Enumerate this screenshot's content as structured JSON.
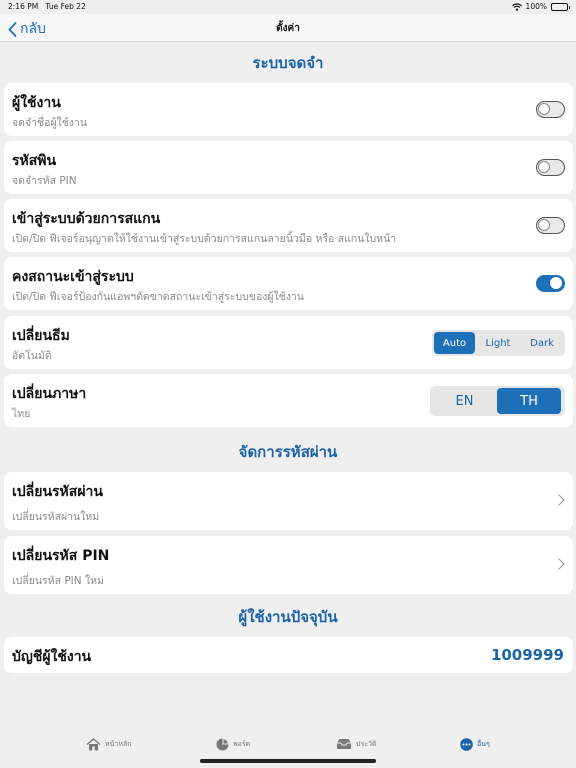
{
  "status": {
    "time": "2:16 PM",
    "date": "Tue Feb 22",
    "battery": "100%"
  },
  "nav": {
    "back_label": "กลับ",
    "title": "ตั้งค่า"
  },
  "sections": {
    "memory": "ระบบจดจำ",
    "password": "จัดการรหัสผ่าน",
    "current_user": "ผู้ใช้งานปัจจุบัน"
  },
  "settings": {
    "username": {
      "title": "ผู้ใช้งาน",
      "subtitle": "จดจำชื่อผู้ใช้งาน",
      "on": false
    },
    "pin": {
      "title": "รหัสพิน",
      "subtitle": "จดจำรหัส PIN",
      "on": false
    },
    "scan": {
      "title": "เข้าสู่ระบบด้วยการสแกน",
      "subtitle": "เปิด/ปิด ฟีเจอร์อนุญาตให้ใช้งานเข้าสู่ระบบด้วยการสแกนลายนิ้วมือ หรือ สแกนใบหน้า",
      "on": false
    },
    "keep_login": {
      "title": "คงสถานะเข้าสู่ระบบ",
      "subtitle": "เปิด/ปิด ฟีเจอร์ป้องกันแอพฯตัดขาดสถานะเข้าสู่ระบบของผู้ใช้งาน",
      "on": true
    },
    "theme": {
      "title": "เปลี่ยนธีม",
      "subtitle": "อัตโนมัติ",
      "options": [
        "Auto",
        "Light",
        "Dark"
      ],
      "selected": "Auto"
    },
    "language": {
      "title": "เปลี่ยนภาษา",
      "subtitle": "ไทย",
      "options": [
        "EN",
        "TH"
      ],
      "selected": "TH"
    }
  },
  "password": {
    "change_password": {
      "title": "เปลี่ยนรหัสผ่าน",
      "subtitle": "เปลี่ยนรหัสผ่านใหม่"
    },
    "change_pin": {
      "title": "เปลี่ยนรหัส PIN",
      "subtitle": "เปลี่ยนรหัส PIN ใหม่"
    }
  },
  "account": {
    "label": "บัญชีผู้ใช้งาน",
    "value": "1009999"
  },
  "tabs": [
    {
      "label": "หน้าหลัก",
      "icon": "home-icon"
    },
    {
      "label": "พอร์ต",
      "icon": "pie-chart-icon"
    },
    {
      "label": "ประวัติ",
      "icon": "inbox-icon"
    },
    {
      "label": "อื่นๆ",
      "icon": "more-icon"
    }
  ],
  "colors": {
    "accent": "#1d6fb8",
    "section_header": "#1c64a8",
    "background": "#efefef"
  }
}
